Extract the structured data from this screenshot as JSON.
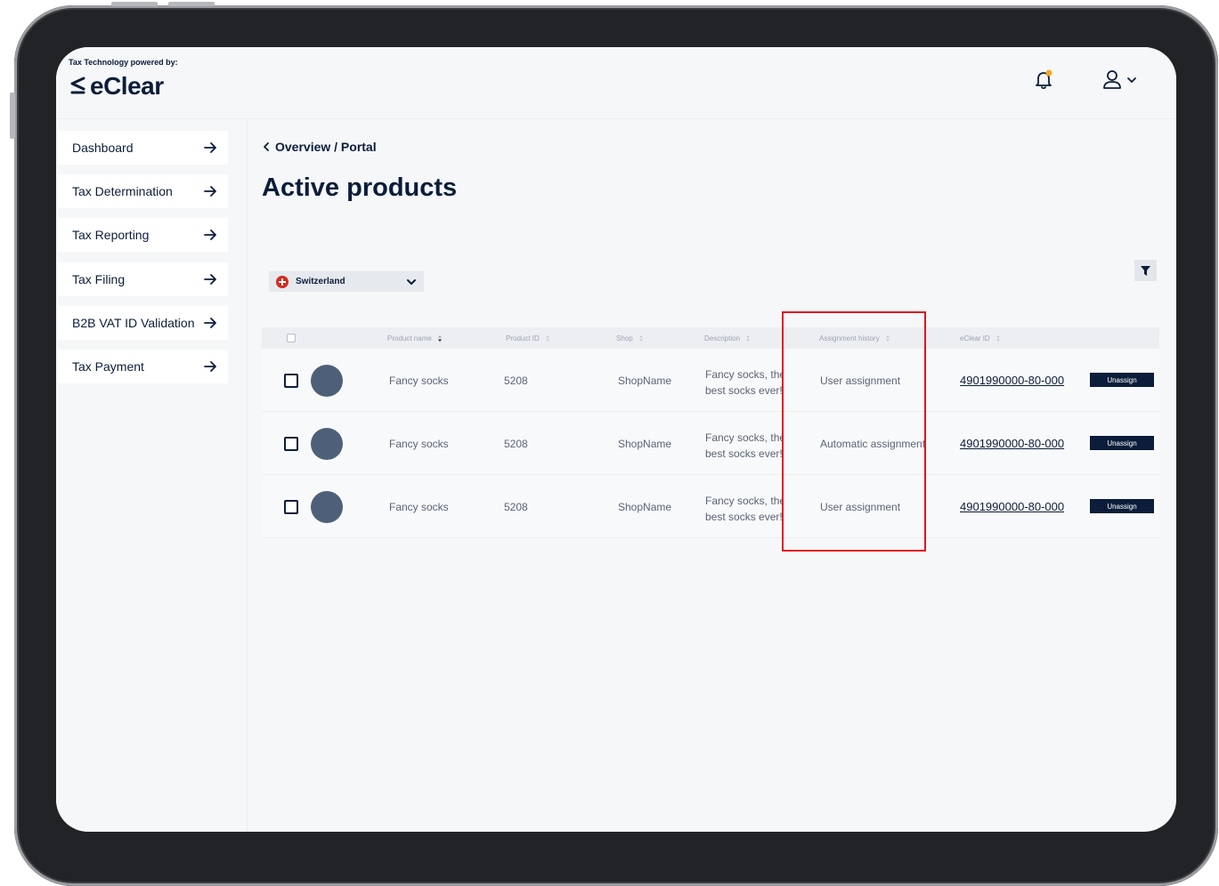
{
  "header": {
    "powered_by": "Tax Technology powered by:",
    "logo_text": "eClear"
  },
  "sidebar": {
    "items": [
      {
        "label": "Dashboard"
      },
      {
        "label": "Tax Determination"
      },
      {
        "label": "Tax Reporting"
      },
      {
        "label": "Tax Filing"
      },
      {
        "label": "B2B VAT ID Validation"
      },
      {
        "label": "Tax Payment"
      }
    ]
  },
  "main": {
    "breadcrumb": "Overview / Portal",
    "title": "Active products",
    "country_select": {
      "selected": "Switzerland"
    }
  },
  "table": {
    "headers": {
      "product_name": "Product name",
      "product_id": "Product ID",
      "shop": "Shop",
      "description": "Description",
      "assignment_history": "Assignment history",
      "eclear_id": "eClear ID"
    },
    "rows": [
      {
        "product_name": "Fancy socks",
        "product_id": "5208",
        "shop": "ShopName",
        "desc_line1": "Fancy socks, the",
        "desc_line2": "best socks ever!",
        "assignment": "User assignment",
        "eclear_id": "4901990000-80-000",
        "action": "Unassign"
      },
      {
        "product_name": "Fancy socks",
        "product_id": "5208",
        "shop": "ShopName",
        "desc_line1": "Fancy socks, the",
        "desc_line2": "best socks ever!",
        "assignment": "Automatic assignment",
        "eclear_id": "4901990000-80-000",
        "action": "Unassign"
      },
      {
        "product_name": "Fancy socks",
        "product_id": "5208",
        "shop": "ShopName",
        "desc_line1": "Fancy socks, the",
        "desc_line2": "best socks ever!",
        "assignment": "User assignment",
        "eclear_id": "4901990000-80-000",
        "action": "Unassign"
      }
    ]
  },
  "colors": {
    "navy": "#0b1d3a",
    "highlight": "#e3141b",
    "notification_dot": "#f5a623",
    "flag_red": "#d52b1e"
  }
}
